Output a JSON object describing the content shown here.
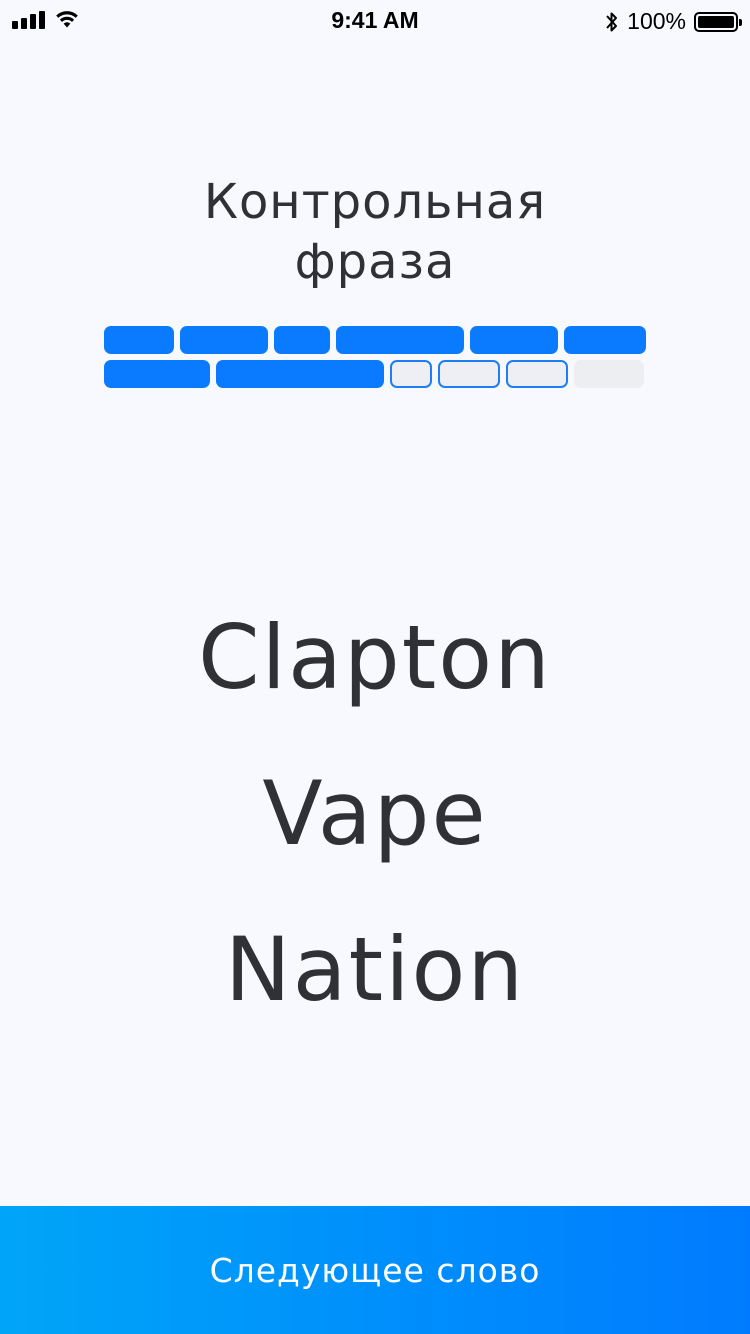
{
  "status_bar": {
    "time": "9:41 AM",
    "battery_percent": "100%",
    "icons": [
      "signal-icon",
      "wifi-icon",
      "bluetooth-icon",
      "battery-icon"
    ]
  },
  "title": {
    "line1": "Контрольная",
    "line2": "фраза"
  },
  "progress": {
    "total_words": 12,
    "completed_words": 8,
    "current_words": 3,
    "states": [
      "done",
      "done",
      "done",
      "done",
      "done",
      "done",
      "done",
      "done",
      "current",
      "current",
      "current",
      "empty"
    ]
  },
  "words": [
    "Clapton",
    "Vape",
    "Nation"
  ],
  "next_button": {
    "label": "Следующее слово"
  },
  "colors": {
    "background": "#F7F9FE",
    "accent": "#0A7BFF",
    "text": "#303134",
    "button_gradient_start": "#00A5F8",
    "button_gradient_end": "#007BFF",
    "empty_block": "#EDEEF2"
  }
}
